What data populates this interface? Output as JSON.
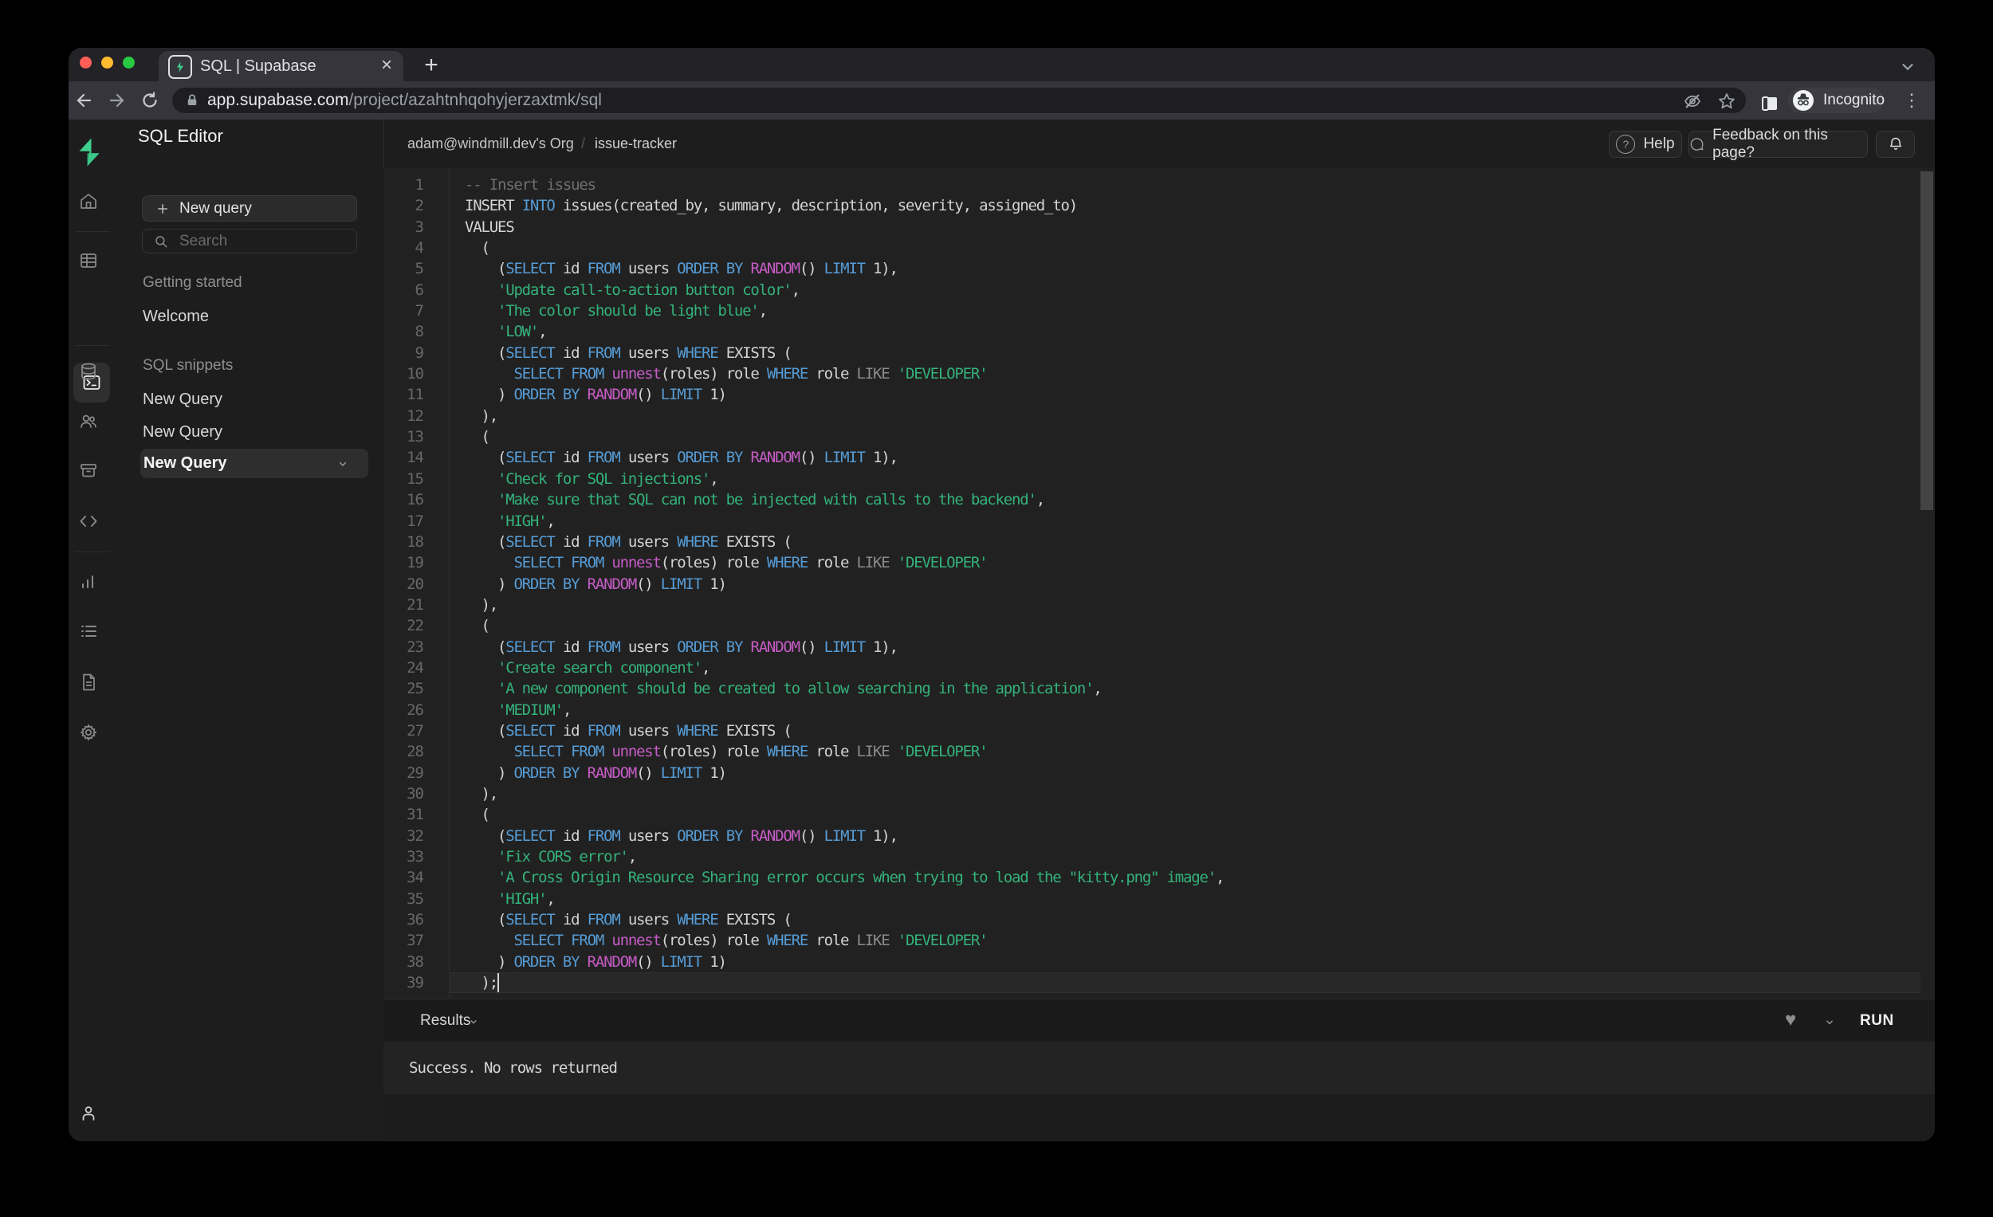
{
  "icons": {
    "close": "×",
    "new_tab": "+",
    "overflow_menu": "⋮",
    "heart": "♥",
    "help_mark": "?"
  },
  "browser": {
    "tab_title": "SQL | Supabase",
    "url_host": "app.supabase.com",
    "url_path": "/project/azahtnhqohyjerzaxtmk/sql",
    "incognito_label": "Incognito"
  },
  "app": {
    "header": {
      "title": "SQL Editor",
      "breadcrumb_org": "adam@windmill.dev's Org",
      "breadcrumb_sep": "/",
      "breadcrumb_project": "issue-tracker",
      "help_label": "Help",
      "feedback_label": "Feedback on this page?"
    },
    "sidebar": {
      "new_query_label": "New query",
      "search_placeholder": "Search",
      "section_getting_started": "Getting started",
      "item_welcome": "Welcome",
      "section_snippets": "SQL snippets",
      "snippets": [
        "New Query",
        "New Query",
        "New Query"
      ]
    },
    "editor": {
      "token_colors": {
        "c": "#6f6f6f",
        "k": "#569cd6",
        "f": "#c65cc6",
        "s": "#34b27b",
        "o": "#8c8c8c",
        "p": "#d4d4d4"
      },
      "accent_green": "#3ecf8e",
      "lines": [
        {
          "tokens": [
            [
              "c",
              "-- Insert issues"
            ]
          ]
        },
        {
          "tokens": [
            [
              "p",
              "INSERT "
            ],
            [
              "k",
              "INTO"
            ],
            [
              "p",
              " issues(created_by, summary, description, severity, assigned_to)"
            ]
          ]
        },
        {
          "tokens": [
            [
              "p",
              "VALUES"
            ]
          ]
        },
        {
          "tokens": [
            [
              "p",
              "  ("
            ]
          ]
        },
        {
          "tokens": [
            [
              "p",
              "    ("
            ],
            [
              "k",
              "SELECT"
            ],
            [
              "p",
              " id "
            ],
            [
              "k",
              "FROM"
            ],
            [
              "p",
              " users "
            ],
            [
              "k",
              "ORDER"
            ],
            [
              "p",
              " "
            ],
            [
              "k",
              "BY"
            ],
            [
              "p",
              " "
            ],
            [
              "f",
              "RANDOM"
            ],
            [
              "p",
              "() "
            ],
            [
              "k",
              "LIMIT"
            ],
            [
              "p",
              " 1),"
            ]
          ]
        },
        {
          "tokens": [
            [
              "p",
              "    "
            ],
            [
              "s",
              "'Update call-to-action button color'"
            ],
            [
              "p",
              ","
            ]
          ]
        },
        {
          "tokens": [
            [
              "p",
              "    "
            ],
            [
              "s",
              "'The color should be light blue'"
            ],
            [
              "p",
              ","
            ]
          ]
        },
        {
          "tokens": [
            [
              "p",
              "    "
            ],
            [
              "s",
              "'LOW'"
            ],
            [
              "p",
              ","
            ]
          ]
        },
        {
          "tokens": [
            [
              "p",
              "    ("
            ],
            [
              "k",
              "SELECT"
            ],
            [
              "p",
              " id "
            ],
            [
              "k",
              "FROM"
            ],
            [
              "p",
              " users "
            ],
            [
              "k",
              "WHERE"
            ],
            [
              "p",
              " EXISTS ("
            ]
          ]
        },
        {
          "tokens": [
            [
              "p",
              "      "
            ],
            [
              "k",
              "SELECT"
            ],
            [
              "p",
              " "
            ],
            [
              "k",
              "FROM"
            ],
            [
              "p",
              " "
            ],
            [
              "f",
              "unnest"
            ],
            [
              "p",
              "(roles) role "
            ],
            [
              "k",
              "WHERE"
            ],
            [
              "p",
              " role "
            ],
            [
              "o",
              "LIKE"
            ],
            [
              "p",
              " "
            ],
            [
              "s",
              "'DEVELOPER'"
            ]
          ]
        },
        {
          "tokens": [
            [
              "p",
              "    ) "
            ],
            [
              "k",
              "ORDER"
            ],
            [
              "p",
              " "
            ],
            [
              "k",
              "BY"
            ],
            [
              "p",
              " "
            ],
            [
              "f",
              "RANDOM"
            ],
            [
              "p",
              "() "
            ],
            [
              "k",
              "LIMIT"
            ],
            [
              "p",
              " 1)"
            ]
          ]
        },
        {
          "tokens": [
            [
              "p",
              "  ),"
            ]
          ]
        },
        {
          "tokens": [
            [
              "p",
              "  ("
            ]
          ]
        },
        {
          "tokens": [
            [
              "p",
              "    ("
            ],
            [
              "k",
              "SELECT"
            ],
            [
              "p",
              " id "
            ],
            [
              "k",
              "FROM"
            ],
            [
              "p",
              " users "
            ],
            [
              "k",
              "ORDER"
            ],
            [
              "p",
              " "
            ],
            [
              "k",
              "BY"
            ],
            [
              "p",
              " "
            ],
            [
              "f",
              "RANDOM"
            ],
            [
              "p",
              "() "
            ],
            [
              "k",
              "LIMIT"
            ],
            [
              "p",
              " 1),"
            ]
          ]
        },
        {
          "tokens": [
            [
              "p",
              "    "
            ],
            [
              "s",
              "'Check for SQL injections'"
            ],
            [
              "p",
              ","
            ]
          ]
        },
        {
          "tokens": [
            [
              "p",
              "    "
            ],
            [
              "s",
              "'Make sure that SQL can not be injected with calls to the backend'"
            ],
            [
              "p",
              ","
            ]
          ]
        },
        {
          "tokens": [
            [
              "p",
              "    "
            ],
            [
              "s",
              "'HIGH'"
            ],
            [
              "p",
              ","
            ]
          ]
        },
        {
          "tokens": [
            [
              "p",
              "    ("
            ],
            [
              "k",
              "SELECT"
            ],
            [
              "p",
              " id "
            ],
            [
              "k",
              "FROM"
            ],
            [
              "p",
              " users "
            ],
            [
              "k",
              "WHERE"
            ],
            [
              "p",
              " EXISTS ("
            ]
          ]
        },
        {
          "tokens": [
            [
              "p",
              "      "
            ],
            [
              "k",
              "SELECT"
            ],
            [
              "p",
              " "
            ],
            [
              "k",
              "FROM"
            ],
            [
              "p",
              " "
            ],
            [
              "f",
              "unnest"
            ],
            [
              "p",
              "(roles) role "
            ],
            [
              "k",
              "WHERE"
            ],
            [
              "p",
              " role "
            ],
            [
              "o",
              "LIKE"
            ],
            [
              "p",
              " "
            ],
            [
              "s",
              "'DEVELOPER'"
            ]
          ]
        },
        {
          "tokens": [
            [
              "p",
              "    ) "
            ],
            [
              "k",
              "ORDER"
            ],
            [
              "p",
              " "
            ],
            [
              "k",
              "BY"
            ],
            [
              "p",
              " "
            ],
            [
              "f",
              "RANDOM"
            ],
            [
              "p",
              "() "
            ],
            [
              "k",
              "LIMIT"
            ],
            [
              "p",
              " 1)"
            ]
          ]
        },
        {
          "tokens": [
            [
              "p",
              "  ),"
            ]
          ]
        },
        {
          "tokens": [
            [
              "p",
              "  ("
            ]
          ]
        },
        {
          "tokens": [
            [
              "p",
              "    ("
            ],
            [
              "k",
              "SELECT"
            ],
            [
              "p",
              " id "
            ],
            [
              "k",
              "FROM"
            ],
            [
              "p",
              " users "
            ],
            [
              "k",
              "ORDER"
            ],
            [
              "p",
              " "
            ],
            [
              "k",
              "BY"
            ],
            [
              "p",
              " "
            ],
            [
              "f",
              "RANDOM"
            ],
            [
              "p",
              "() "
            ],
            [
              "k",
              "LIMIT"
            ],
            [
              "p",
              " 1),"
            ]
          ]
        },
        {
          "tokens": [
            [
              "p",
              "    "
            ],
            [
              "s",
              "'Create search component'"
            ],
            [
              "p",
              ","
            ]
          ]
        },
        {
          "tokens": [
            [
              "p",
              "    "
            ],
            [
              "s",
              "'A new component should be created to allow searching in the application'"
            ],
            [
              "p",
              ","
            ]
          ]
        },
        {
          "tokens": [
            [
              "p",
              "    "
            ],
            [
              "s",
              "'MEDIUM'"
            ],
            [
              "p",
              ","
            ]
          ]
        },
        {
          "tokens": [
            [
              "p",
              "    ("
            ],
            [
              "k",
              "SELECT"
            ],
            [
              "p",
              " id "
            ],
            [
              "k",
              "FROM"
            ],
            [
              "p",
              " users "
            ],
            [
              "k",
              "WHERE"
            ],
            [
              "p",
              " EXISTS ("
            ]
          ]
        },
        {
          "tokens": [
            [
              "p",
              "      "
            ],
            [
              "k",
              "SELECT"
            ],
            [
              "p",
              " "
            ],
            [
              "k",
              "FROM"
            ],
            [
              "p",
              " "
            ],
            [
              "f",
              "unnest"
            ],
            [
              "p",
              "(roles) role "
            ],
            [
              "k",
              "WHERE"
            ],
            [
              "p",
              " role "
            ],
            [
              "o",
              "LIKE"
            ],
            [
              "p",
              " "
            ],
            [
              "s",
              "'DEVELOPER'"
            ]
          ]
        },
        {
          "tokens": [
            [
              "p",
              "    ) "
            ],
            [
              "k",
              "ORDER"
            ],
            [
              "p",
              " "
            ],
            [
              "k",
              "BY"
            ],
            [
              "p",
              " "
            ],
            [
              "f",
              "RANDOM"
            ],
            [
              "p",
              "() "
            ],
            [
              "k",
              "LIMIT"
            ],
            [
              "p",
              " 1)"
            ]
          ]
        },
        {
          "tokens": [
            [
              "p",
              "  ),"
            ]
          ]
        },
        {
          "tokens": [
            [
              "p",
              "  ("
            ]
          ]
        },
        {
          "tokens": [
            [
              "p",
              "    ("
            ],
            [
              "k",
              "SELECT"
            ],
            [
              "p",
              " id "
            ],
            [
              "k",
              "FROM"
            ],
            [
              "p",
              " users "
            ],
            [
              "k",
              "ORDER"
            ],
            [
              "p",
              " "
            ],
            [
              "k",
              "BY"
            ],
            [
              "p",
              " "
            ],
            [
              "f",
              "RANDOM"
            ],
            [
              "p",
              "() "
            ],
            [
              "k",
              "LIMIT"
            ],
            [
              "p",
              " 1),"
            ]
          ]
        },
        {
          "tokens": [
            [
              "p",
              "    "
            ],
            [
              "s",
              "'Fix CORS error'"
            ],
            [
              "p",
              ","
            ]
          ]
        },
        {
          "tokens": [
            [
              "p",
              "    "
            ],
            [
              "s",
              "'A Cross Origin Resource Sharing error occurs when trying to load the \"kitty.png\" image'"
            ],
            [
              "p",
              ","
            ]
          ]
        },
        {
          "tokens": [
            [
              "p",
              "    "
            ],
            [
              "s",
              "'HIGH'"
            ],
            [
              "p",
              ","
            ]
          ]
        },
        {
          "tokens": [
            [
              "p",
              "    ("
            ],
            [
              "k",
              "SELECT"
            ],
            [
              "p",
              " id "
            ],
            [
              "k",
              "FROM"
            ],
            [
              "p",
              " users "
            ],
            [
              "k",
              "WHERE"
            ],
            [
              "p",
              " EXISTS ("
            ]
          ]
        },
        {
          "tokens": [
            [
              "p",
              "      "
            ],
            [
              "k",
              "SELECT"
            ],
            [
              "p",
              " "
            ],
            [
              "k",
              "FROM"
            ],
            [
              "p",
              " "
            ],
            [
              "f",
              "unnest"
            ],
            [
              "p",
              "(roles) role "
            ],
            [
              "k",
              "WHERE"
            ],
            [
              "p",
              " role "
            ],
            [
              "o",
              "LIKE"
            ],
            [
              "p",
              " "
            ],
            [
              "s",
              "'DEVELOPER'"
            ]
          ]
        },
        {
          "tokens": [
            [
              "p",
              "    ) "
            ],
            [
              "k",
              "ORDER"
            ],
            [
              "p",
              " "
            ],
            [
              "k",
              "BY"
            ],
            [
              "p",
              " "
            ],
            [
              "f",
              "RANDOM"
            ],
            [
              "p",
              "() "
            ],
            [
              "k",
              "LIMIT"
            ],
            [
              "p",
              " 1)"
            ]
          ]
        },
        {
          "tokens": [
            [
              "p",
              "  );"
            ]
          ]
        }
      ]
    },
    "results": {
      "label": "Results",
      "run_label": "RUN",
      "message": "Success. No rows returned"
    }
  }
}
